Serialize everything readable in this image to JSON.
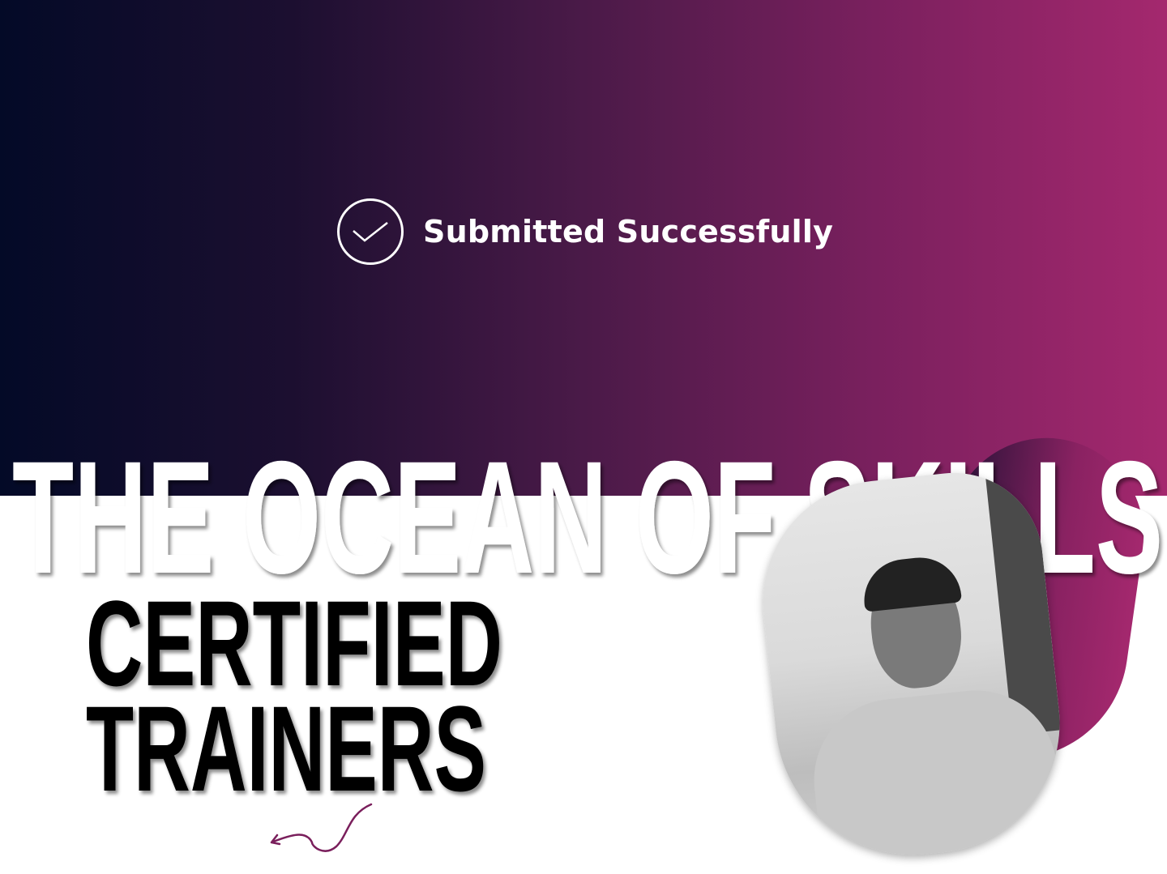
{
  "status": {
    "message": "Submitted Successfully",
    "icon": "check-circle-icon"
  },
  "banner": {
    "headline": "THE OCEAN OF SKILLS",
    "line1": "CERTIFIED",
    "line2": "TRAINERS"
  },
  "colors": {
    "gradient_start": "#030a27",
    "gradient_end": "#a4286e",
    "accent": "#7a1f5c"
  }
}
